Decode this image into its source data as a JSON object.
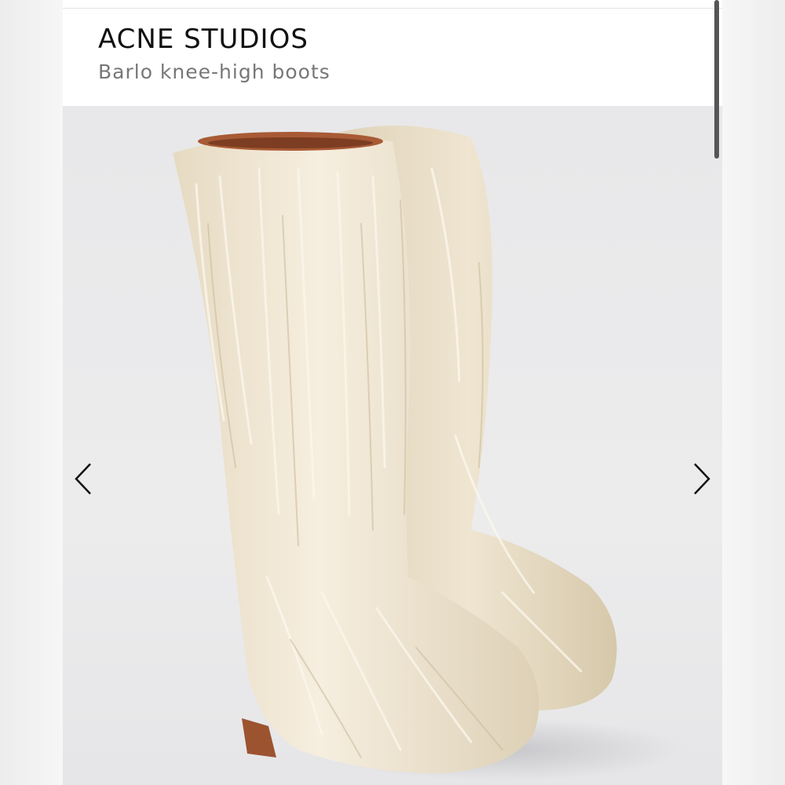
{
  "product": {
    "brand": "ACNE STUDIOS",
    "name": "Barlo knee-high boots"
  },
  "gallery": {
    "image_description_icon": "boot-photo",
    "prev_icon": "chevron-left-icon",
    "next_icon": "chevron-right-icon"
  },
  "colors": {
    "fur": "#f1e7d3",
    "fur_shadow": "#d9ccb1",
    "leather": "#a85a35",
    "background": "#e9e9ea"
  }
}
